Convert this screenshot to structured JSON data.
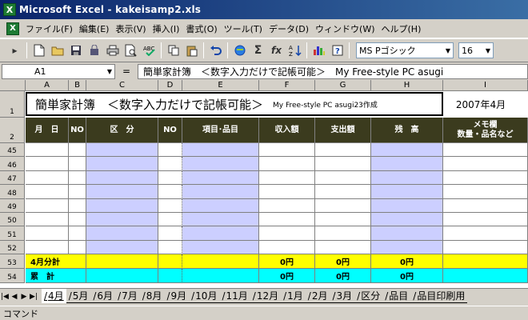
{
  "window": {
    "title": "Microsoft Excel - kakeisamp2.xls",
    "app_icon": "excel-icon",
    "app_icon_glyph": "X"
  },
  "menu": {
    "items": [
      "ファイル(F)",
      "編集(E)",
      "表示(V)",
      "挿入(I)",
      "書式(O)",
      "ツール(T)",
      "データ(D)",
      "ウィンドウ(W)",
      "ヘルプ(H)"
    ]
  },
  "toolbar": {
    "buttons": [
      "run-macro-icon",
      "new-icon",
      "open-icon",
      "save-icon",
      "permission-icon",
      "print-icon",
      "print-preview-icon",
      "spelling-icon",
      "copy-icon",
      "paste-icon",
      "undo-icon",
      "hyperlink-icon",
      "autosum-icon",
      "function-icon",
      "sort-icon",
      "chart-icon",
      "help-icon"
    ],
    "font_name": "MS Pゴシック",
    "font_size": "16"
  },
  "formula_bar": {
    "name_box": "A1",
    "equals": "=",
    "content": "簡単家計簿　＜数字入力だけで記帳可能＞　My Free-style PC asugi"
  },
  "columns": [
    "A",
    "B",
    "C",
    "D",
    "E",
    "F",
    "G",
    "H",
    "I"
  ],
  "sheet": {
    "title": "簡単家計簿　＜数字入力だけで記帳可能＞",
    "subtitle": "My Free-style PC asugi23作成",
    "date": "2007年4月",
    "headers": [
      "月　日",
      "NO",
      "区　分",
      "NO",
      "項目･品目",
      "収入額",
      "支出額",
      "残　高",
      "メモ欄\n数量・品名など"
    ],
    "row_numbers": [
      "1",
      "2",
      "45",
      "46",
      "47",
      "48",
      "49",
      "50",
      "51",
      "52",
      "53",
      "54"
    ],
    "month_total": {
      "label": "4月分計",
      "income": "0円",
      "expense": "0円",
      "balance": "0円"
    },
    "cumulative": {
      "label": "累　計",
      "income": "0円",
      "expense": "0円",
      "balance": "0円"
    }
  },
  "tabs": [
    "4月",
    "5月",
    "6月",
    "7月",
    "8月",
    "9月",
    "10月",
    "11月",
    "12月",
    "1月",
    "2月",
    "3月",
    "区分",
    "品目",
    "品目印刷用"
  ],
  "active_tab": "4月",
  "status": "コマンド",
  "colors": {
    "header_bg": "#3b3b1e",
    "input_bg": "#cccfff",
    "month_total_bg": "#ffff00",
    "cumulative_bg": "#00ffff"
  }
}
